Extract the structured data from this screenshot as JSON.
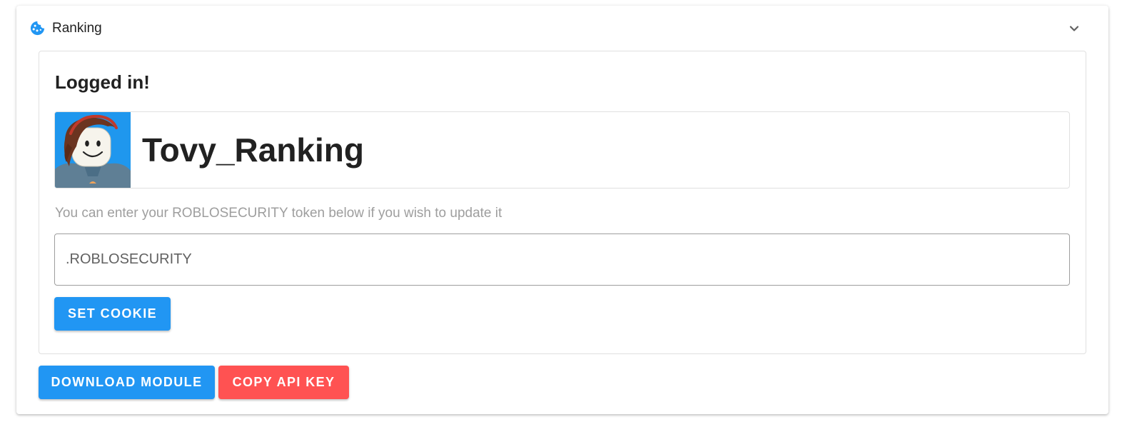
{
  "panel": {
    "title": "Ranking",
    "icon": "cookie-icon",
    "expand_icon": "chevron-down-icon"
  },
  "login_card": {
    "title": "Logged in!",
    "profile": {
      "username": "Tovy_Ranking",
      "avatar": "roblox-avatar"
    },
    "hint": "You can enter your ROBLOSECURITY token below if you wish to update it",
    "token_input": {
      "placeholder": ".ROBLOSECURITY",
      "value": ""
    },
    "set_cookie_label": "Set Cookie"
  },
  "actions": {
    "download_label": "Download Module",
    "copy_key_label": "Copy API Key"
  },
  "colors": {
    "primary": "#2196f3",
    "danger": "#ff5252",
    "avatar_background": "#1f97ee"
  }
}
